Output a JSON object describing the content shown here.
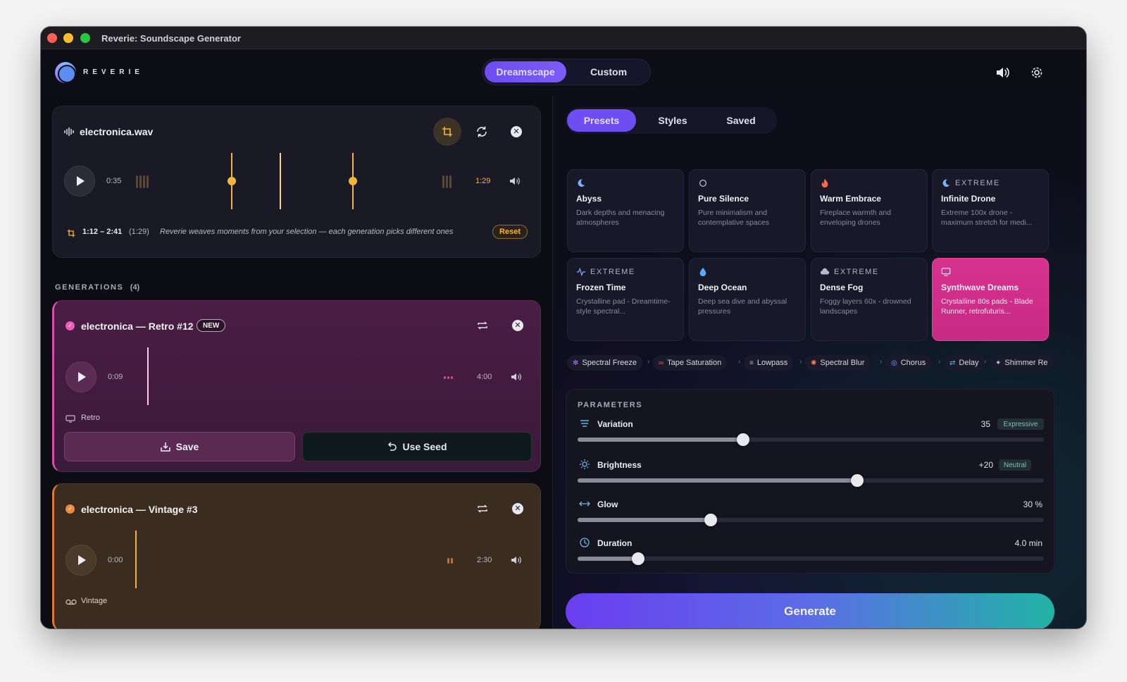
{
  "window": {
    "title": "Reverie: Soundscape Generator"
  },
  "app": {
    "logo_text": "REVERIE",
    "modes": [
      "Dreamscape",
      "Custom"
    ],
    "active_mode": "Dreamscape"
  },
  "source": {
    "filename": "electronica.wav",
    "current_time": "0:35",
    "duration": "1:29",
    "selection_range": "1:12 – 2:41",
    "selection_length": "(1:29)",
    "hint": "Reverie weaves moments from your selection — each generation picks different ones",
    "reset_label": "Reset"
  },
  "generations": {
    "heading": "GENERATIONS",
    "count": "(4)",
    "items": [
      {
        "title": "electronica — Retro #12",
        "badge": "NEW",
        "current_time": "0:09",
        "duration": "4:00",
        "style": "Retro",
        "save_label": "Save",
        "seed_label": "Use Seed",
        "color": "#d94fa8",
        "progress": 0.04
      },
      {
        "title": "electronica — Vintage #3",
        "current_time": "0:00",
        "duration": "2:30",
        "style": "Vintage",
        "color": "#e07a2f",
        "progress": 0.0
      }
    ]
  },
  "panel": {
    "tabs": [
      "Presets",
      "Styles",
      "Saved"
    ],
    "active_tab": "Presets",
    "presets": [
      {
        "tag": "",
        "icon": "moon-icon",
        "name": "Abyss",
        "desc": "Dark depths and menacing atmospheres"
      },
      {
        "tag": "",
        "icon": "circle-icon",
        "name": "Pure Silence",
        "desc": "Pure minimalism and contemplative spaces"
      },
      {
        "tag": "",
        "icon": "flame-icon",
        "name": "Warm Embrace",
        "desc": "Fireplace warmth and enveloping drones"
      },
      {
        "tag": "EXTREME",
        "icon": "moon-icon",
        "name": "Infinite Drone",
        "desc": "Extreme 100x drone - maximum stretch for medi..."
      },
      {
        "tag": "EXTREME",
        "icon": "pulse-icon",
        "name": "Frozen Time",
        "desc": "Crystalline pad - Dreamtime-style spectral..."
      },
      {
        "tag": "",
        "icon": "droplet-icon",
        "name": "Deep Ocean",
        "desc": "Deep sea dive and abyssal pressures"
      },
      {
        "tag": "EXTREME",
        "icon": "cloud-icon",
        "name": "Dense Fog",
        "desc": "Foggy layers 60x - drowned landscapes"
      },
      {
        "tag": "",
        "icon": "monitor-icon",
        "name": "Synthwave Dreams",
        "desc": "Crystalline 80s pads - Blade Runner, retrofuturis..."
      }
    ],
    "selected_preset": "Synthwave Dreams",
    "chain": [
      "Spectral Freeze",
      "Tape Saturation",
      "Lowpass",
      "Spectral Blur",
      "Chorus",
      "Delay",
      "Shimmer Re"
    ],
    "params_heading": "PARAMETERS",
    "params": [
      {
        "name": "Variation",
        "value": "35",
        "badge": "Expressive",
        "level": 0.355
      },
      {
        "name": "Brightness",
        "value": "+20",
        "badge": "Neutral",
        "level": 0.6
      },
      {
        "name": "Glow",
        "value": "30 %",
        "badge": "",
        "level": 0.285
      },
      {
        "name": "Duration",
        "value": "4.0 min",
        "badge": "",
        "level": 0.13
      }
    ],
    "generate_label": "Generate"
  },
  "colors": {
    "accent": "#6e4ef3",
    "pink": "#d94fa8",
    "orange": "#e07a2f",
    "selection": "#f3b53a"
  }
}
